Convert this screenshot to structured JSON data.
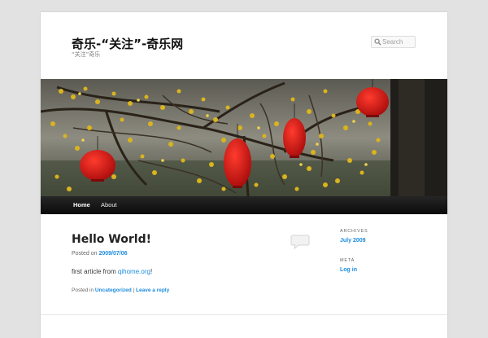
{
  "header": {
    "site_title": "奇乐-“关注”-奇乐网",
    "site_description": "“关注”奇乐",
    "search_placeholder": "Search"
  },
  "nav": {
    "items": [
      {
        "label": "Home"
      },
      {
        "label": "About"
      }
    ]
  },
  "post": {
    "title": "Hello World!",
    "posted_on_prefix": "Posted on ",
    "date": "2009/07/06",
    "body_prefix": "first article from ",
    "body_link": "qihome.org",
    "body_suffix": "!",
    "posted_in_prefix": "Posted in ",
    "category": "Uncategorized",
    "separator": " | ",
    "reply_link": "Leave a reply"
  },
  "sidebar": {
    "archives_title": "ARCHIVES",
    "archives_link": "July 2009",
    "meta_title": "META",
    "meta_link": "Log in"
  },
  "colors": {
    "link": "#1b8be0",
    "background": "#e2e2e2",
    "nav_dark": "#0b0b0b"
  }
}
